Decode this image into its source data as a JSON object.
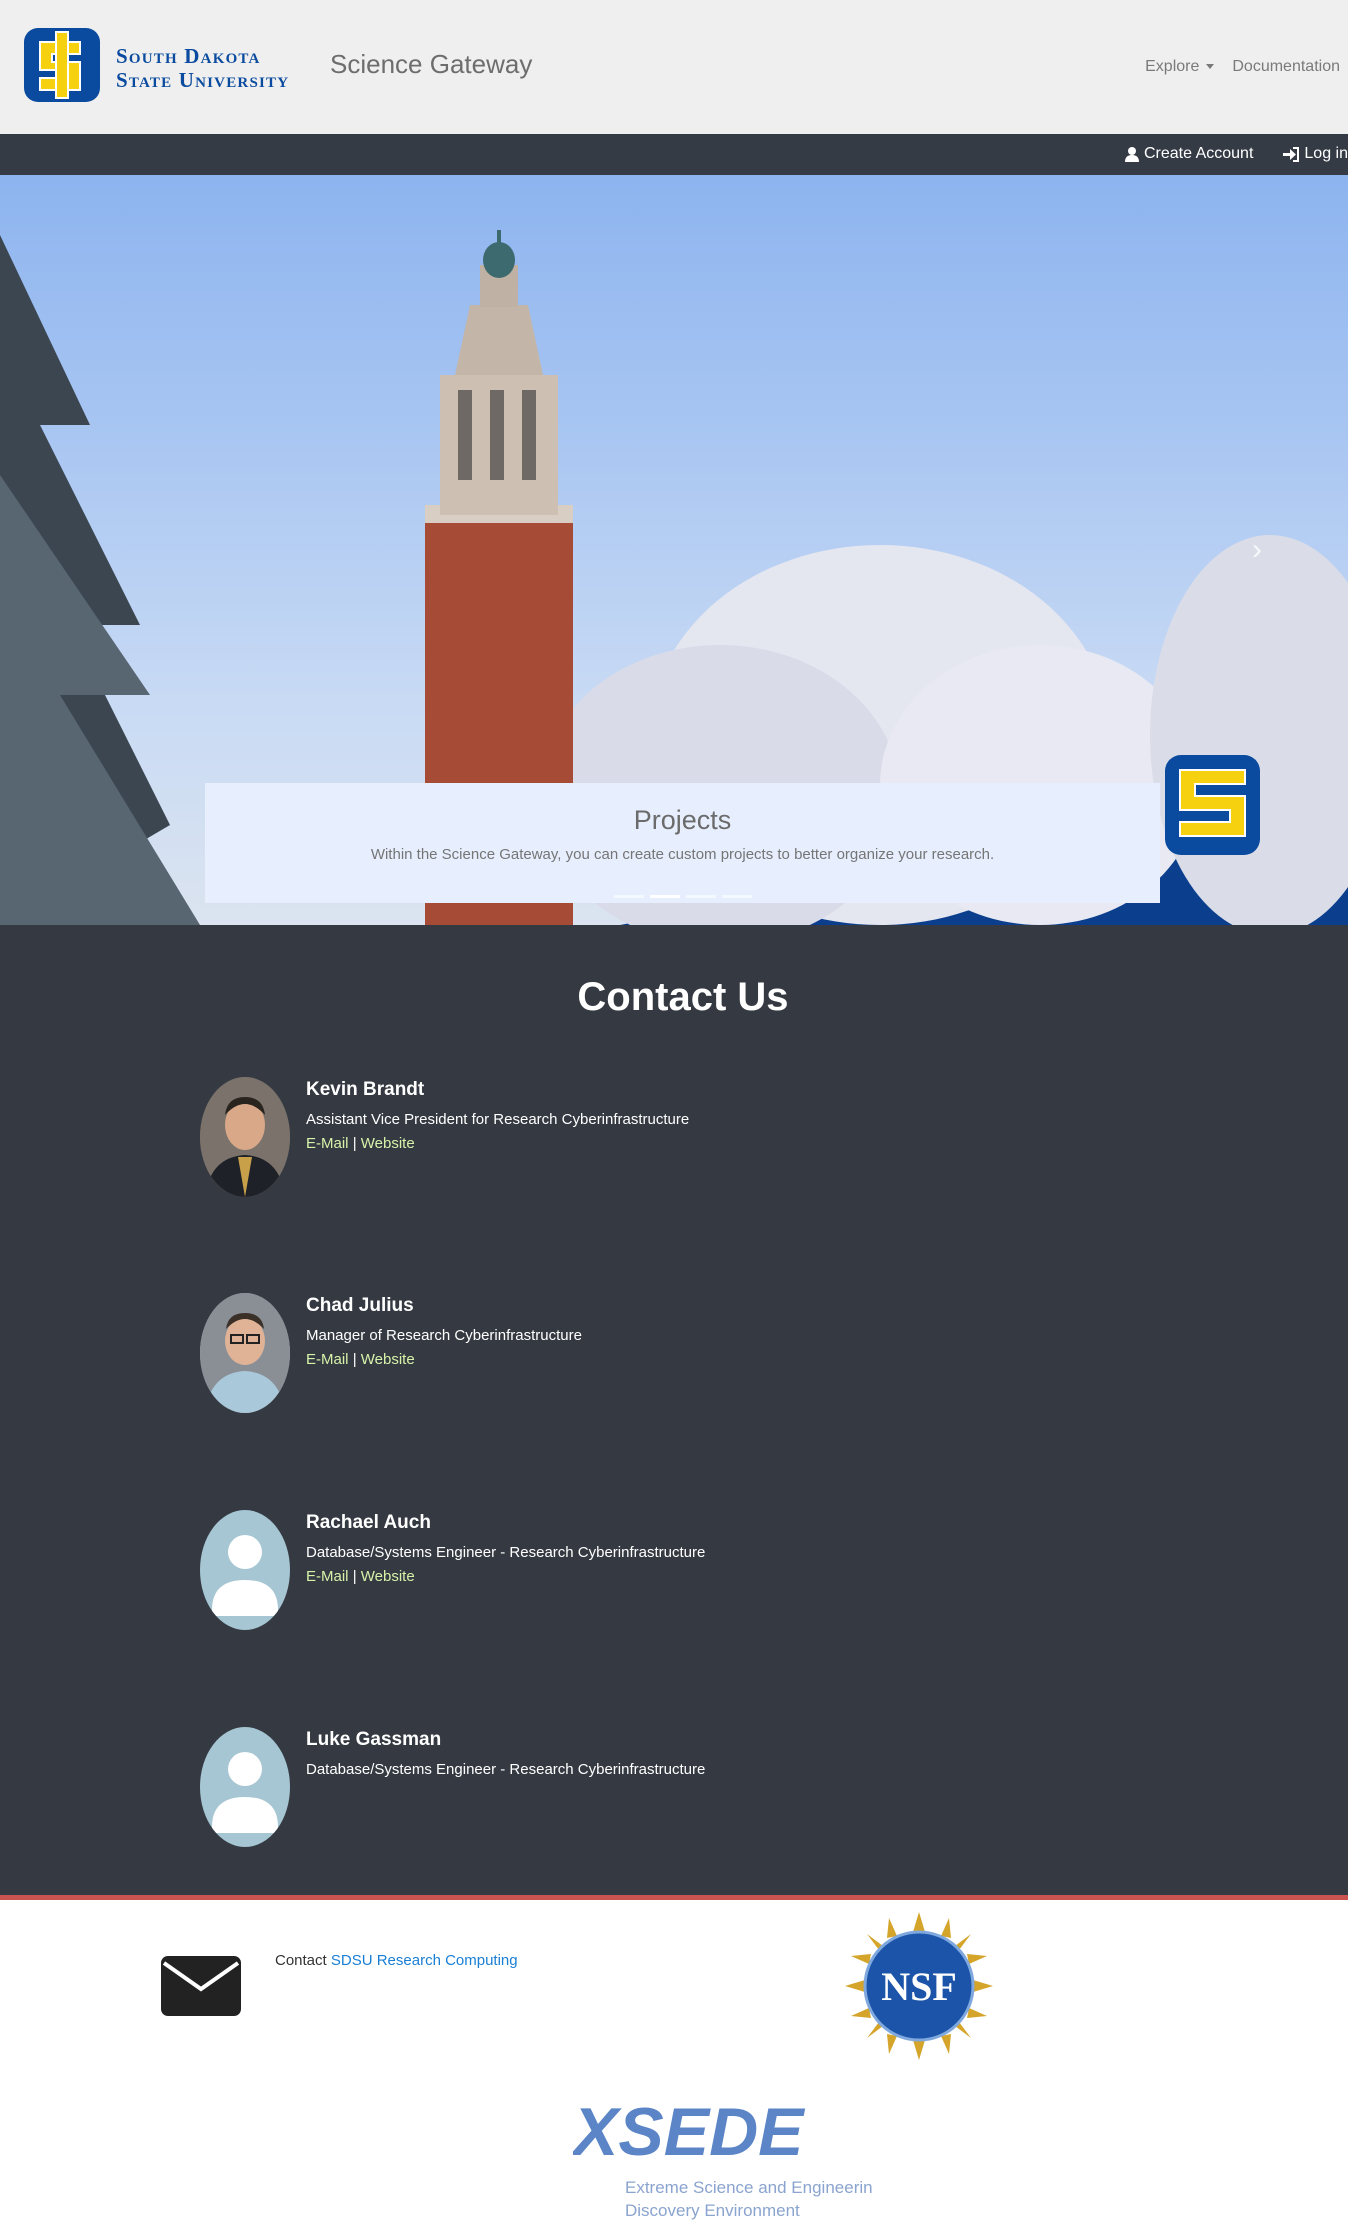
{
  "header": {
    "university_line1": "South Dakota",
    "university_line2": "State University",
    "site_title": "Science Gateway",
    "nav": [
      {
        "label": "Explore",
        "has_dropdown": true
      },
      {
        "label": "Documentation",
        "has_dropdown": false
      }
    ]
  },
  "account_bar": {
    "create_account": "Create Account",
    "log_in": "Log in"
  },
  "carousel": {
    "caption_title": "Projects",
    "caption_text": "Within the Science Gateway, you can create custom projects to better organize your research.",
    "indicator_count": 4,
    "active_indicator": 2
  },
  "contact": {
    "heading": "Contact Us",
    "people": [
      {
        "name": "Kevin Brandt",
        "title": "Assistant Vice President for Research Cyberinfrastructure",
        "email_label": "E-Mail",
        "separator": "|",
        "website_label": "Website",
        "photo": "photo"
      },
      {
        "name": "Chad Julius",
        "title": "Manager of Research Cyberinfrastructure",
        "email_label": "E-Mail",
        "separator": "|",
        "website_label": "Website",
        "photo": "photo"
      },
      {
        "name": "Rachael Auch",
        "title": "Database/Systems Engineer - Research Cyberinfrastructure",
        "email_label": "E-Mail",
        "separator": "|",
        "website_label": "Website",
        "photo": "placeholder"
      },
      {
        "name": "Luke Gassman",
        "title": "Database/Systems Engineer - Research Cyberinfrastructure",
        "photo": "placeholder"
      }
    ]
  },
  "footer": {
    "contact_prefix": "Contact",
    "contact_link": "SDSU Research Computing",
    "nsf_logo_text": "NSF",
    "xsede_logo_text": "XSEDE",
    "xsede_tagline_1": "Extreme Science and Engineering",
    "xsede_tagline_2": "Discovery Environment"
  },
  "colors": {
    "sdsu_blue": "#0a4b9f",
    "sdsu_yellow": "#f5d10f",
    "dark_bar": "#353b45",
    "link_green": "#d7f2a9",
    "footer_link": "#1a7fd4",
    "accent_red": "#c8534f"
  }
}
